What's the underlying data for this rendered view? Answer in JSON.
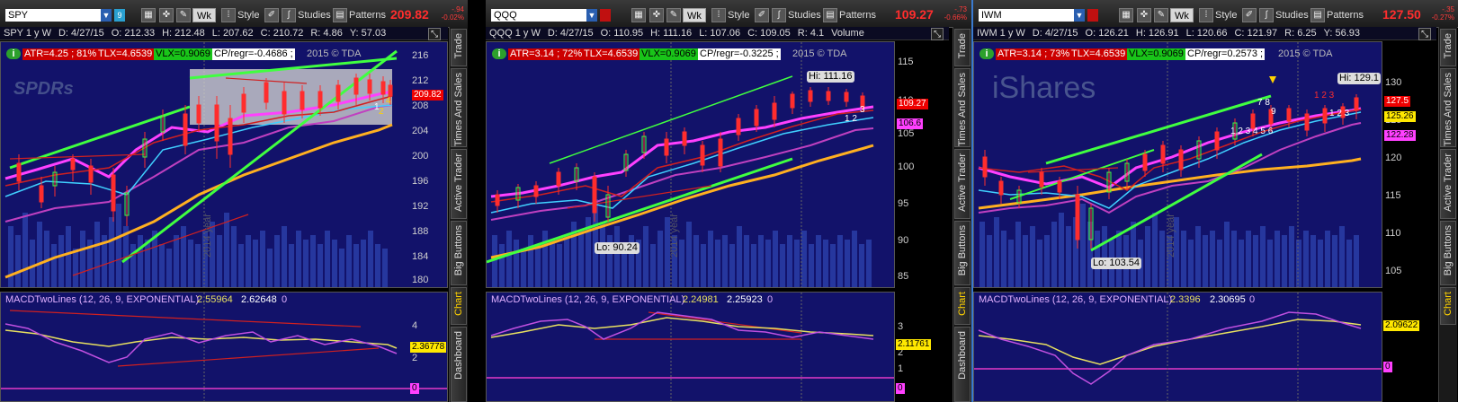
{
  "colors": {
    "up": "#ff2d2d",
    "down": "#ff2d2d",
    "panel_bg": "#12126a",
    "accent": "#ffd200"
  },
  "panels": [
    {
      "symbol": "SPY",
      "link_badge": "9",
      "aggregation": "Wk",
      "style_label": "Style",
      "studies_label": "Studies",
      "patterns_label": "Patterns",
      "last_price": "209.82",
      "change": "-.94",
      "change_pct": "-0.02%",
      "period": "SPY 1 y W",
      "date": "D: 4/27/15",
      "open": "O: 212.33",
      "high": "H: 212.48",
      "low": "L: 207.62",
      "close": "C: 210.72",
      "range": "R: 4.86",
      "extra": "Y: 57.03",
      "atr": "ATR=4.25 ; 81%",
      "tlx": "TLX=4.6539",
      "vlx": "VLX=0.9069",
      "cpregr": "CP/regr=-0.4686 ;",
      "copyright": "2015 © TDA",
      "watermark": "SPDRs",
      "year_label": "2014 year",
      "price_tag": "209.82",
      "y_ticks": [
        "216",
        "212",
        "208",
        "204",
        "200",
        "196",
        "192",
        "188",
        "184",
        "180"
      ],
      "macd_label": "MACDTwoLines (12, 26, 9, EXPONENTIAL)",
      "macd_v1": "2.55964",
      "macd_v2": "2.62648",
      "macd_v3": "0",
      "macd_ticks": [
        "4",
        "2",
        "0"
      ],
      "macd_tag": "2.36778",
      "zero_tag": "0"
    },
    {
      "symbol": "QQQ",
      "aggregation": "Wk",
      "style_label": "Style",
      "studies_label": "Studies",
      "patterns_label": "Patterns",
      "last_price": "109.27",
      "change": "-.73",
      "change_pct": "-0.66%",
      "period": "QQQ 1 y W",
      "date": "D: 4/27/15",
      "open": "O: 110.95",
      "high": "H: 111.16",
      "low": "L: 107.06",
      "close": "C: 109.05",
      "range": "R: 4.1",
      "extra": "Volume",
      "atr": "ATR=3.14 ; 72%",
      "tlx": "TLX=4.6539",
      "vlx": "VLX=0.9069",
      "cpregr": "CP/regr=-0.3225 ;",
      "copyright": "2015 © TDA",
      "year_label": "2014 year",
      "hi_label": "Hi: 111.16",
      "lo_label": "Lo: 90.24",
      "price_tag": "109.27",
      "price_tag2": "106.6",
      "y_ticks": [
        "115",
        "110",
        "105",
        "100",
        "95",
        "90",
        "85"
      ],
      "macd_label": "MACDTwoLines (12, 26, 9, EXPONENTIAL)",
      "macd_v1": "2.24981",
      "macd_v2": "2.25923",
      "macd_v3": "0",
      "macd_ticks": [
        "3",
        "2",
        "1",
        "0"
      ],
      "macd_tag": "2.11761",
      "zero_tag": "0"
    },
    {
      "symbol": "IWM",
      "aggregation": "Wk",
      "style_label": "Style",
      "studies_label": "Studies",
      "patterns_label": "Patterns",
      "last_price": "127.50",
      "change": "-.35",
      "change_pct": "-0.27%",
      "period": "IWM 1 y W",
      "date": "D: 4/27/15",
      "open": "O: 126.21",
      "high": "H: 126.91",
      "low": "L: 120.66",
      "close": "C: 121.97",
      "range": "R: 6.25",
      "extra": "Y: 56.93",
      "atr": "ATR=3.14 ; 73%",
      "tlx": "TLX=4.6539",
      "vlx": "VLX=0.9069",
      "cpregr": "CP/regr=0.2573 ;",
      "copyright": "2015 © TDA",
      "watermark": "iShares",
      "year_label": "2014 year",
      "hi_label": "Hi: 129.1",
      "lo_label": "Lo: 103.54",
      "price_tag": "127.5",
      "price_tag2": "125.26",
      "price_tag3": "122.28",
      "y_ticks": [
        "130",
        "125",
        "120",
        "115",
        "110",
        "105"
      ],
      "macd_label": "MACDTwoLines (12, 26, 9, EXPONENTIAL)",
      "macd_v1": "2.3396",
      "macd_v2": "2.30695",
      "macd_v3": "0",
      "macd_tag": "2.09622",
      "zero_tag": "0"
    }
  ],
  "side_tabs": [
    "Trade",
    "Times And Sales",
    "Active Trader",
    "Big Buttons",
    "Chart",
    "Dashboard"
  ]
}
